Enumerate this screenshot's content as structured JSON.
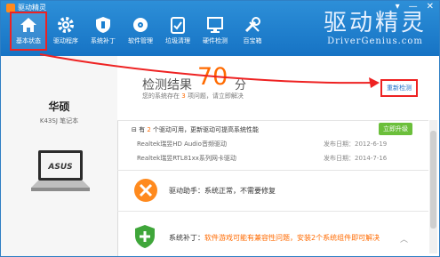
{
  "app": {
    "title": "驱动精灵"
  },
  "window_controls": [
    "▾",
    "—",
    "✕"
  ],
  "nav": [
    {
      "label": "基本状态",
      "icon": "home-icon",
      "active": true
    },
    {
      "label": "驱动程序",
      "icon": "gear-icon",
      "active": false
    },
    {
      "label": "系统补丁",
      "icon": "shield-icon",
      "active": false
    },
    {
      "label": "软件管理",
      "icon": "disc-icon",
      "active": false
    },
    {
      "label": "垃圾清理",
      "icon": "trash-icon",
      "active": false
    },
    {
      "label": "硬件检测",
      "icon": "monitor-icon",
      "active": false
    },
    {
      "label": "百宝箱",
      "icon": "tools-icon",
      "active": false
    }
  ],
  "brand": {
    "logo_text": "驱动精灵",
    "url": "DriverGenius.com"
  },
  "device": {
    "brand": "华硕",
    "model": "K43SJ 笔记本",
    "screen_logo": "ASUS"
  },
  "result": {
    "label": "检测结果",
    "score": "70",
    "unit": "分",
    "sub_prefix": "您的系统存在",
    "issues": "3",
    "sub_suffix": "项问题，请立即解决",
    "redetect": "重新检测"
  },
  "drivers": {
    "title_prefix": "有",
    "count": "2",
    "title_suffix": "个驱动可用，更新驱动可提高系统性能",
    "upgrade": "立即升级",
    "items": [
      {
        "name": "Realtek瑞昱HD Audio音频驱动",
        "date": "发布日期：2012-6-19"
      },
      {
        "name": "Realtek瑞昱RTL81xx系列网卡驱动",
        "date": "发布日期：2014-7-16"
      }
    ]
  },
  "helper": {
    "label": "驱动助手：",
    "text": "系统正常，不需要修复"
  },
  "patch": {
    "label": "系统补丁：",
    "text": "软件游戏可能有兼容性问题，安装2个系统组件即可解决"
  },
  "colors": {
    "titlebar": "#1a7fd0",
    "accent": "#ff6a00",
    "link": "#1f6fc8",
    "highlight": "#e22222",
    "upgrade": "#6bbf3b"
  }
}
